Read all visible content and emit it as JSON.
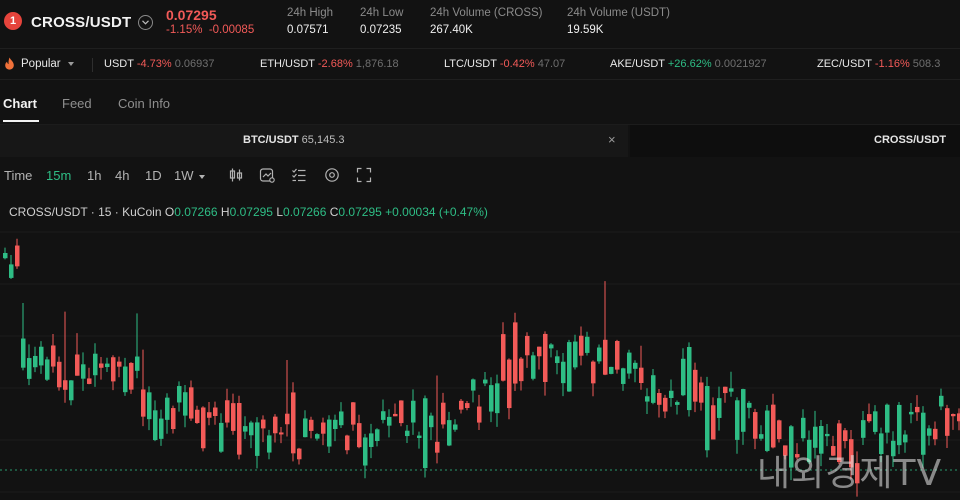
{
  "header": {
    "badge": "1",
    "pair": "CROSS/USDT",
    "last_price": "0.07295",
    "change_pct": "-1.15%",
    "change_abs": "-0.00085",
    "stats": [
      {
        "label": "24h High",
        "value": "0.07571"
      },
      {
        "label": "24h Low",
        "value": "0.07235"
      },
      {
        "label": "24h Volume (CROSS)",
        "value": "267.40K"
      },
      {
        "label": "24h Volume (USDT)",
        "value": "19.59K"
      }
    ]
  },
  "ticker": {
    "popular_label": "Popular",
    "items": [
      {
        "symbol": "USDT",
        "change": "-4.73%",
        "price": "0.06937",
        "direction": "down"
      },
      {
        "symbol": "ETH/USDT",
        "change": "-2.68%",
        "price": "1,876.18",
        "direction": "down"
      },
      {
        "symbol": "LTC/USDT",
        "change": "-0.42%",
        "price": "47.07",
        "direction": "down"
      },
      {
        "symbol": "AKE/USDT",
        "change": "+26.62%",
        "price": "0.0021927",
        "direction": "up"
      },
      {
        "symbol": "ZEC/USDT",
        "change": "-1.16%",
        "price": "508.3",
        "direction": "down"
      }
    ]
  },
  "tabs": [
    {
      "label": "Chart",
      "active": true
    },
    {
      "label": "Feed",
      "active": false
    },
    {
      "label": "Coin Info",
      "active": false
    }
  ],
  "chart_tabs": {
    "first_symbol": "BTC/USDT",
    "first_price": "65,145.3",
    "close_glyph": "×",
    "second_symbol": "CROSS/USDT"
  },
  "toolbar": {
    "time_label": "Time",
    "intervals": [
      {
        "label": "15m",
        "active": true
      },
      {
        "label": "1h",
        "active": false
      },
      {
        "label": "4h",
        "active": false
      },
      {
        "label": "1D",
        "active": false
      },
      {
        "label": "1W",
        "active": false
      }
    ],
    "icons": [
      "candlestick-type-icon",
      "indicators-icon",
      "drawing-tools-icon",
      "settings-icon",
      "fullscreen-icon"
    ]
  },
  "legend": {
    "title": "CROSS/USDT · 15 · KuCoin",
    "open_key": "O",
    "open": "0.07266",
    "high_key": "H",
    "high": "0.07295",
    "low_key": "L",
    "low": "0.07266",
    "close_key": "C",
    "close": "0.07295",
    "change": "+0.00034 (+0.47%)"
  },
  "watermark": "내외경제TV",
  "colors": {
    "up": "#2ebd85",
    "down": "#f25a58",
    "background": "#121212"
  }
}
